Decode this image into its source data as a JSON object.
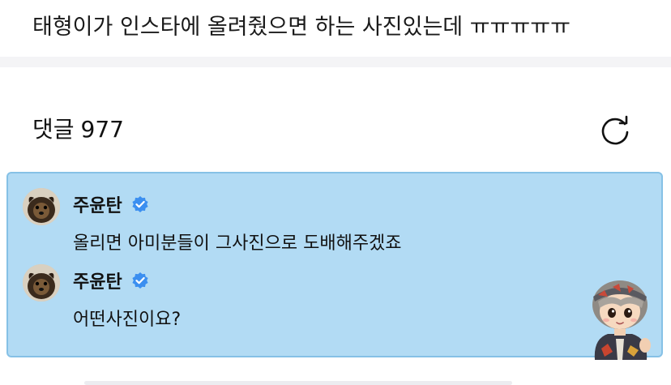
{
  "post": {
    "title": "태형이가 인스타에 올려줬으면 하는 사진있는데 ㅠㅠㅠㅠㅠ"
  },
  "comments": {
    "header_label": "댓글",
    "count": "977",
    "refresh_icon": "refresh-icon",
    "items": [
      {
        "author": "주윤탄",
        "verified": true,
        "avatar_icon": "dog-avatar-icon",
        "text": "올리면 아미분들이 그사진으로 도배해주겠죠"
      },
      {
        "author": "주윤탄",
        "verified": true,
        "avatar_icon": "dog-avatar-icon",
        "text": "어떤사진이요?"
      }
    ],
    "sticker": "character-sticker",
    "highlight_color": "#b2dbf4",
    "verified_color": "#3b8ff0"
  }
}
